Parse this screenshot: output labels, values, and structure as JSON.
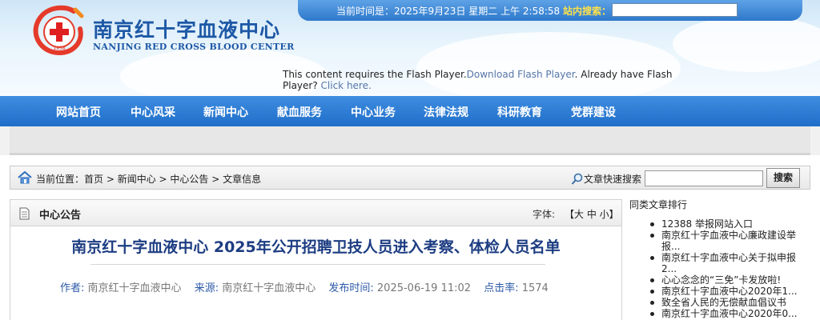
{
  "header": {
    "logo_cn": "南京红十字血液中心",
    "logo_en": "NANJING RED CROSS BLOOD CENTER",
    "logo_year": "1958",
    "current_time": "当前时间是：2025年9月23日 星期二 上午 2:58:58",
    "site_search_label": "站内搜索："
  },
  "flash": {
    "message": "This content requires the Flash Player.",
    "download_link": "Download Flash Player",
    "already": ". Already have Flash Player?",
    "click_here": " Click here."
  },
  "nav": {
    "items": [
      "网站首页",
      "中心风采",
      "新闻中心",
      "献血服务",
      "中心业务",
      "法律法规",
      "科研教育",
      "党群建设"
    ]
  },
  "breadcrumb": {
    "label": "当前位置：",
    "items": [
      "首页",
      "新闻中心",
      "中心公告",
      "文章信息"
    ],
    "separator": " > ",
    "quick_search_label": "文章快速搜索",
    "search_button": "搜索"
  },
  "article": {
    "section": "中心公告",
    "font_label": "字体:",
    "font_options": "【大 中 小】",
    "title": "南京红十字血液中心 2025年公开招聘卫技人员进入考察、体检人员名单",
    "meta": {
      "author_label": "作者:",
      "author": "南京红十字血液中心",
      "source_label": "来源:",
      "source": "南京红十字血液中心",
      "date_label": "发布时间:",
      "date": "2025-06-19 11:02",
      "hits_label": "点击率:",
      "hits": "1574"
    }
  },
  "sidebar": {
    "title": "同类文章排行",
    "items": [
      "12388 举报网站入口",
      "南京红十字血液中心廉政建设举报...",
      "南京红十字血液中心关于拟申报2...",
      "心心念念的“三免”卡发放啦!",
      "南京红十字血液中心2020年1...",
      "致全省人民的无偿献血倡议书",
      "南京红十字血液中心2020年0..."
    ]
  },
  "colors": {
    "brand_blue": "#1d58a6",
    "nav_blue": "#2a7bd5",
    "title_blue": "#1d3d82",
    "search_yellow": "#ffe24a"
  }
}
